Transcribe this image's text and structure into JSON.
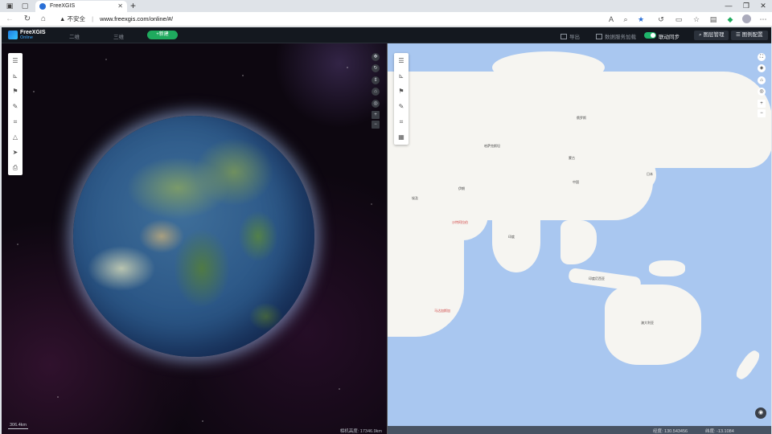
{
  "browser": {
    "tab_title": "FreeXGIS",
    "url_warning": "不安全",
    "url": "www.freexgis.com/online/#/"
  },
  "app": {
    "brand_name": "FreeXGIS",
    "brand_sub": "Online",
    "mode_tabs": [
      "二维",
      "三维"
    ],
    "primary_button": "+新建",
    "header_items": [
      "导出",
      "数据服务加载"
    ],
    "sync_label": "联动同步",
    "sync_on": true,
    "header_buttons": [
      "图层管理",
      "图例配置"
    ],
    "accent_color": "#1faa5e"
  },
  "pane3d": {
    "scale_label": "306.4km",
    "status_text": "相机高度: 17346.9km"
  },
  "pane2d": {
    "status_items": [
      "经度: 130.543456",
      "纬度: -13.1084"
    ],
    "labels": [
      {
        "text": "俄罗斯"
      },
      {
        "text": "中国"
      },
      {
        "text": "蒙古"
      },
      {
        "text": "哈萨克斯坦"
      },
      {
        "text": "印度"
      },
      {
        "text": "日本"
      },
      {
        "text": "澳大利亚"
      },
      {
        "text": "印度尼西亚"
      },
      {
        "text": "伊朗"
      },
      {
        "text": "沙特阿拉伯"
      },
      {
        "text": "埃及"
      },
      {
        "text": "马达加斯加"
      }
    ]
  },
  "left_toolbar": [
    "list-icon",
    "ruler-icon",
    "flag-icon",
    "pen-icon",
    "crop-icon",
    "area-icon",
    "send-icon",
    "printer-icon"
  ],
  "map_toolbar": [
    "list-icon",
    "ruler-icon",
    "flag-icon",
    "pen-icon",
    "crop-icon",
    "grid-icon"
  ],
  "globe_controls": [
    "compass-icon",
    "rotate-icon",
    "tilt-icon",
    "home-icon",
    "target-icon",
    "zoom-in-icon",
    "zoom-out-icon"
  ],
  "map_controls": [
    "fullscreen-icon",
    "layers-icon",
    "home-icon",
    "target-icon",
    "zoom-in-icon",
    "zoom-out-icon"
  ]
}
